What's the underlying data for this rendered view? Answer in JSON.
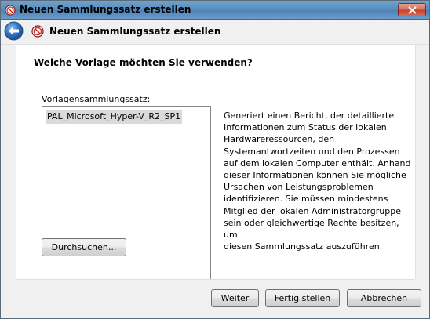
{
  "window": {
    "title": "Neuen Sammlungssatz erstellen",
    "title_icon": "no-entry-icon",
    "close_icon": "close-x-icon"
  },
  "header": {
    "back_icon": "back-arrow-icon",
    "icon": "no-entry-icon",
    "title": "Neuen Sammlungssatz erstellen"
  },
  "main": {
    "question": "Welche Vorlage möchten Sie verwenden?",
    "list_label": "Vorlagensammlungssatz:",
    "list_items": [
      "PAL_Microsoft_Hyper-V_R2_SP1"
    ],
    "selected_item": "PAL_Microsoft_Hyper-V_R2_SP1",
    "description_lines": [
      "Generiert einen Bericht, der detaillierte",
      "Informationen zum Status der lokalen",
      "Hardwareressourcen, den",
      "Systemantwortzeiten und den Prozessen",
      "auf dem lokalen Computer enthält. Anhand",
      "dieser Informationen können Sie mögliche",
      "Ursachen von Leistungsproblemen",
      "identifizieren. Sie müssen mindestens",
      "Mitglied der lokalen Administratorgruppe",
      "sein oder gleichwertige Rechte besitzen, um",
      "diesen Sammlungssatz auszuführen."
    ],
    "browse_label": "Durchsuchen..."
  },
  "footer": {
    "next_label": "Weiter",
    "finish_label": "Fertig stellen",
    "cancel_label": "Abbrechen"
  },
  "colors": {
    "title_bar": "#5a8fbf",
    "close_button": "#c14431",
    "selection": "#dadada",
    "back_button": "#2f6fbf"
  }
}
